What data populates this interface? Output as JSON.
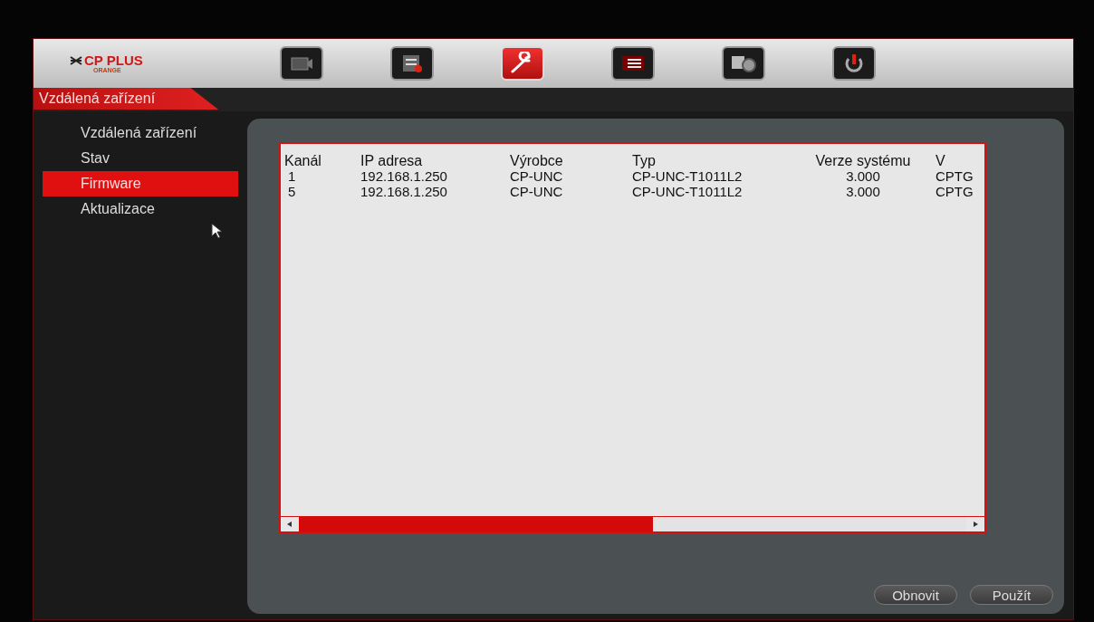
{
  "logo": {
    "brand": "CP PLUS",
    "sub": "ORANGE"
  },
  "toolbar": [
    {
      "kind": "camera",
      "selected": false
    },
    {
      "kind": "document",
      "selected": false
    },
    {
      "kind": "wrench",
      "selected": true
    },
    {
      "kind": "list",
      "selected": false
    },
    {
      "kind": "devices",
      "selected": false
    },
    {
      "kind": "power",
      "selected": false
    }
  ],
  "section_title": "Vzdálená zařízení",
  "sidebar": {
    "items": [
      {
        "label": "Vzdálená zařízení",
        "selected": false
      },
      {
        "label": "Stav",
        "selected": false
      },
      {
        "label": "Firmware",
        "selected": true
      },
      {
        "label": "Aktualizace",
        "selected": false
      }
    ]
  },
  "table": {
    "columns": [
      "Kanál",
      "IP adresa",
      "Výrobce",
      "Typ",
      "Verze systému",
      "V"
    ],
    "rows": [
      [
        "1",
        "192.168.1.250",
        "CP-UNC",
        "CP-UNC-T1011L2",
        "3.000",
        "CPTG"
      ],
      [
        "5",
        "192.168.1.250",
        "CP-UNC",
        "CP-UNC-T1011L2",
        "3.000",
        "CPTG"
      ]
    ]
  },
  "buttons": [
    "Obnovit",
    "Použít"
  ]
}
